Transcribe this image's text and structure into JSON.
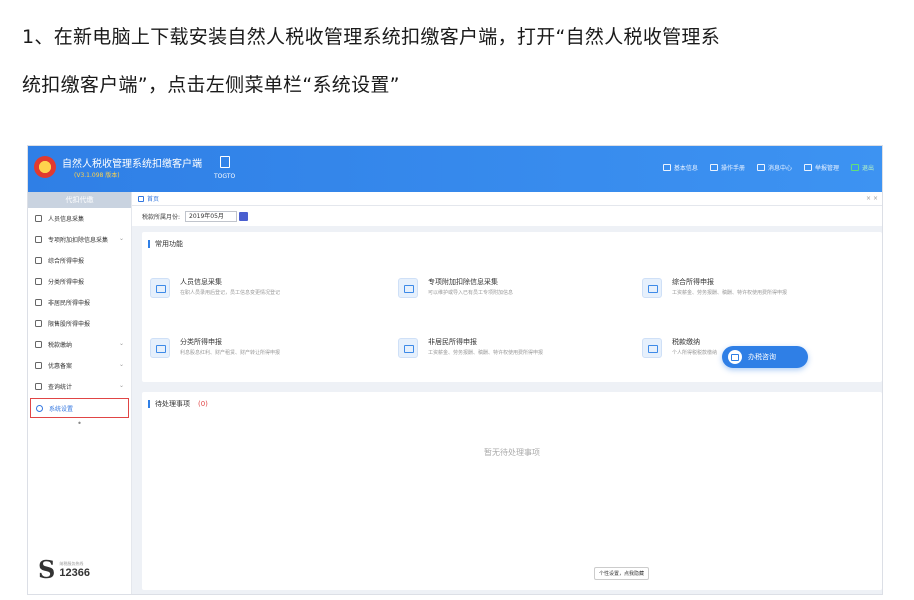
{
  "instruction": {
    "line1": "1、在新电脑上下载安装自然人税收管理系统扣缴客户端，打开“自然人税收管理系",
    "line2": "统扣缴客户端”，点击左侧菜单栏“系统设置”"
  },
  "header": {
    "title": "自然人税收管理系统扣缴客户端",
    "subtitle": "(V3.1.098 版本)",
    "company_caption": "TOGTO",
    "nav": [
      {
        "label": "基本信息",
        "icon": "info-icon"
      },
      {
        "label": "操作手册",
        "icon": "book-icon"
      },
      {
        "label": "消息中心",
        "icon": "mail-icon"
      },
      {
        "label": "举报管理",
        "icon": "report-icon"
      },
      {
        "label": "退出",
        "icon": "exit-icon"
      }
    ]
  },
  "sidebar": {
    "header": "代扣代缴",
    "items": [
      {
        "label": "人员信息采集",
        "icon": "person-icon",
        "chevron": ""
      },
      {
        "label": "专项附加扣除信息采集",
        "icon": "list-icon",
        "chevron": "⌄"
      },
      {
        "label": "综合所得申报",
        "icon": "chart-icon",
        "chevron": ""
      },
      {
        "label": "分类所得申报",
        "icon": "clock-icon",
        "chevron": ""
      },
      {
        "label": "非居民所得申报",
        "icon": "user-icon",
        "chevron": ""
      },
      {
        "label": "限售股所得申报",
        "icon": "bar-icon",
        "chevron": ""
      },
      {
        "label": "税款缴纳",
        "icon": "wallet-icon",
        "chevron": "⌄"
      },
      {
        "label": "优惠备案",
        "icon": "doc-icon",
        "chevron": "⌄"
      },
      {
        "label": "查询统计",
        "icon": "search-icon",
        "chevron": "⌄"
      }
    ],
    "settings_label": "系统设置",
    "logo_number": "12366",
    "logo_small": "纳税服务热线"
  },
  "main": {
    "tab_label": "首页",
    "period_label": "税款所属月份:",
    "period_value": "2019年05月",
    "common_title": "常用功能",
    "functions": [
      {
        "name": "人员信息采集",
        "desc": "在职人员录用后登记，员工信息变更情况登记"
      },
      {
        "name": "专项附加扣除信息采集",
        "desc": "可以维护或导入已有员工专项附加信息"
      },
      {
        "name": "综合所得申报",
        "desc": "工资薪金、劳务报酬、稿酬、特许权使用费所得申报"
      },
      {
        "name": "分类所得申报",
        "desc": "利息股息红利、财产租赁、财产转让所得申报"
      },
      {
        "name": "非居民所得申报",
        "desc": "工资薪金、劳务报酬、稿酬、特许权使用费所得申报"
      },
      {
        "name": "税款缴纳",
        "desc": "个人所得税税款缴纳"
      }
    ],
    "float_btn": "办税咨询",
    "pending_title": "待处理事项",
    "pending_count": "(0)",
    "empty_text": "暂无待处理事项",
    "tooltip": "个性设置，点我隐藏"
  }
}
